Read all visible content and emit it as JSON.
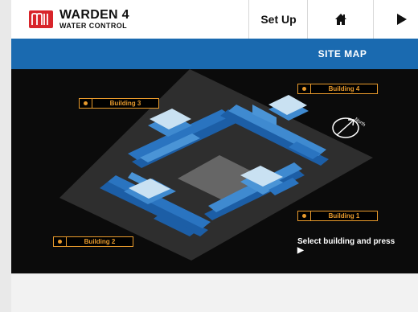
{
  "header": {
    "brand_title": "WARDEN 4",
    "brand_subtitle": "WATER CONTROL",
    "setup_label": "Set Up",
    "home_icon": "home-icon",
    "play_icon": "play-icon"
  },
  "bar": {
    "title": "SITE MAP"
  },
  "map": {
    "buildings": [
      {
        "label": "Building 4"
      },
      {
        "label": "Building 3"
      },
      {
        "label": "Building 1"
      },
      {
        "label": "Building 2"
      }
    ],
    "compass_label": "North",
    "hint": "Select building and press ▶"
  },
  "colors": {
    "brand_red": "#d8252b",
    "header_blue": "#1a6ab0",
    "label_orange": "#e89a2c",
    "map_bg": "#0b0b0b"
  }
}
